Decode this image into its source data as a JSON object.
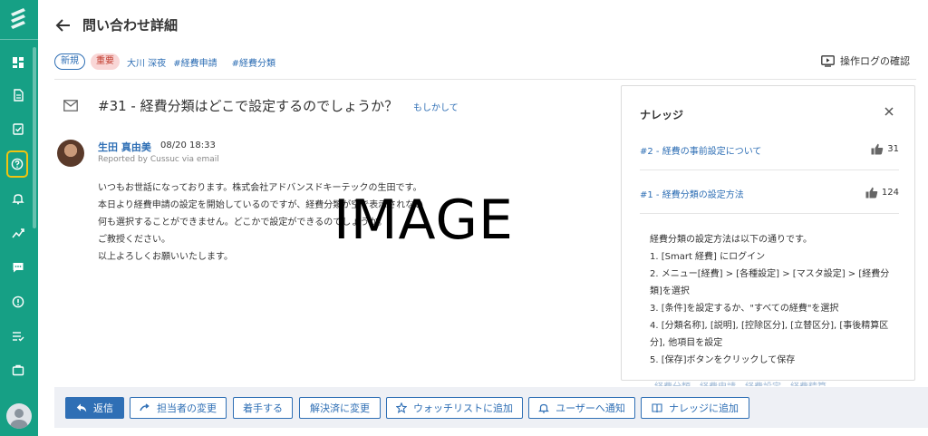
{
  "header": {
    "title": "問い合わせ詳細",
    "oplog_label": "操作ログの確認"
  },
  "tags": {
    "status": "新規",
    "priority": "重要",
    "assignee": "大川 深夜",
    "tag1": "#経費申請",
    "tag2": "#経費分類"
  },
  "ticket": {
    "subject": "#31 - 経費分類はどこで設定するのでしょうか？",
    "perhaps": "もしかして",
    "author": "生田 真由美",
    "time": "08/20 18:33",
    "via": "Reported by Cussuc via email",
    "body": [
      "いつもお世話になっております。株式会社アドバンスドキーテックの生田です。",
      "本日より経費申請の設定を開始しているのですが、経費分類が空で表示されない",
      "何も選択することができません。どこかで設定ができるのでしょうか。",
      "ご教授ください。",
      "以上よろしくお願いいたします。"
    ]
  },
  "placeholder_text": "IMAGE",
  "knowledge": {
    "title": "ナレッジ",
    "items": [
      {
        "title": "#2 - 経費の事前設定について",
        "likes": "31"
      },
      {
        "title": "#1 - 経費分類の設定方法",
        "likes": "124"
      }
    ],
    "content": [
      "経費分類の設定方法は以下の通りです。",
      "1. [Smart 経費] にログイン",
      "2. メニュー[経費] > [各種設定] > [マスタ設定] > [経費分",
      "類]を選択",
      "3. [条件]を設定するか、\"すべての経費\"を選択",
      "4. [分類名称], [説明], [控除区分], [立替区分], [事後精算区",
      "分], 他項目を設定",
      "5. [保存]ボタンをクリックして保存"
    ],
    "ghost_links": "経費分類　経費申請　経費設定　経費精算"
  },
  "actions": {
    "reply": "返信",
    "change_assignee": "担当者の変更",
    "start": "着手する",
    "resolved": "解決済に変更",
    "watchlist": "ウォッチリストに追加",
    "notify": "ユーザーへ通知",
    "add_knowledge": "ナレッジに追加"
  },
  "colors": {
    "sidebar": "#16a085",
    "accent": "#2f6fb5",
    "active_outline": "#f1c40f",
    "priority_bg": "#f9d6d6",
    "action_bar": "#eef0f5"
  },
  "icons": {
    "sidebar": [
      "logo-icon",
      "dashboard-icon",
      "document-icon",
      "checklist-icon",
      "help-icon",
      "bell-icon",
      "analytics-icon",
      "chat-icon",
      "alert-icon",
      "list-icon",
      "briefcase-icon",
      "user-icon"
    ]
  }
}
